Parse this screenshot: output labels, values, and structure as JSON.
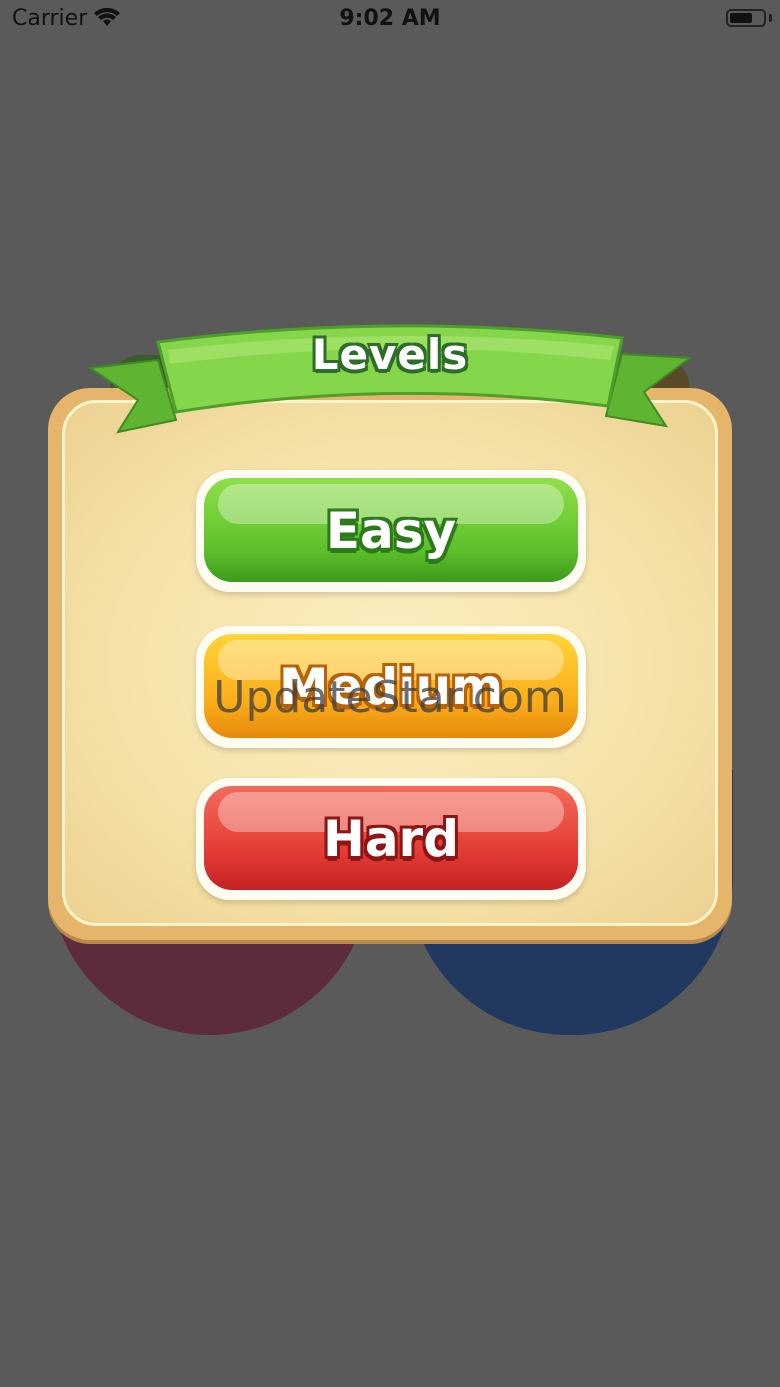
{
  "status_bar": {
    "carrier": "Carrier",
    "time": "9:02 AM",
    "wifi_icon": "wifi-icon",
    "battery_icon": "battery-icon"
  },
  "dialog": {
    "title": "Levels",
    "buttons": {
      "easy": "Easy",
      "medium": "Medium",
      "hard": "Hard"
    }
  },
  "watermark": "UpdateStar.com",
  "colors": {
    "background": "#5a5a5a",
    "panel": "#f5e2a8",
    "ribbon": "#7bd145",
    "easy": "#5dbf2a",
    "medium": "#fbad1a",
    "hard": "#e23b34"
  }
}
